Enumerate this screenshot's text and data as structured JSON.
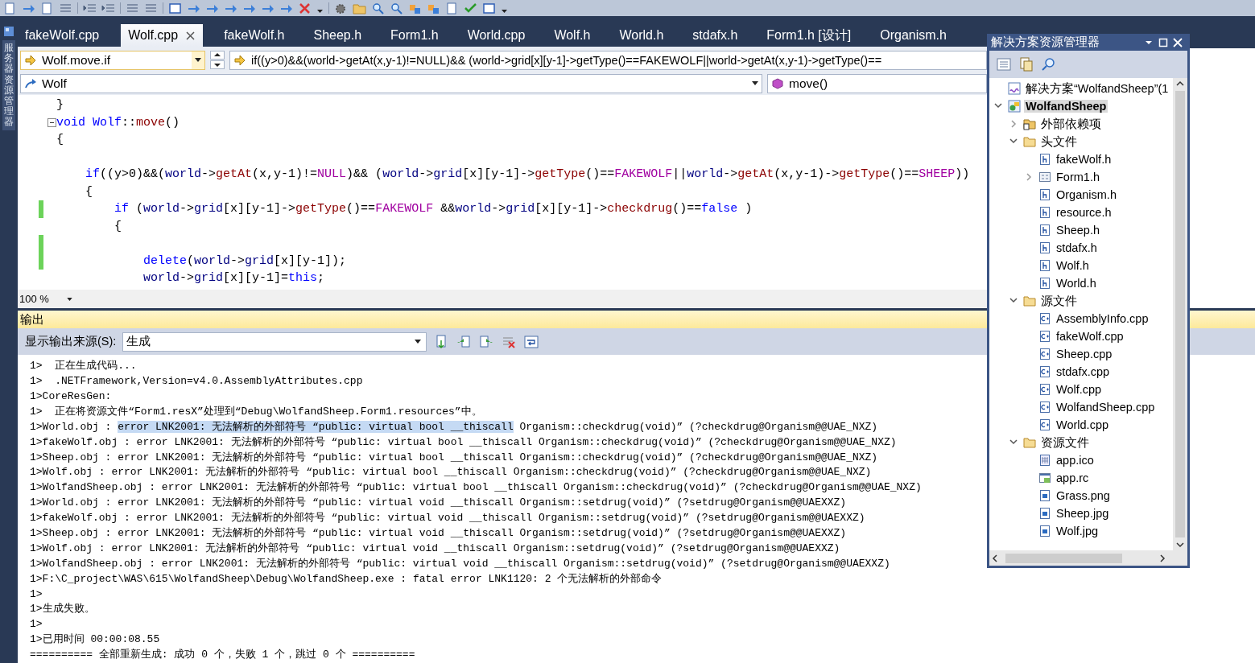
{
  "side_tab": {
    "label": "服务器资源管理器"
  },
  "tabs": [
    {
      "label": "fakeWolf.cpp",
      "selected": false
    },
    {
      "label": "Wolf.cpp",
      "selected": true
    },
    {
      "label": "fakeWolf.h",
      "selected": false
    },
    {
      "label": "Sheep.h",
      "selected": false
    },
    {
      "label": "Form1.h",
      "selected": false
    },
    {
      "label": "World.cpp",
      "selected": false
    },
    {
      "label": "Wolf.h",
      "selected": false
    },
    {
      "label": "World.h",
      "selected": false
    },
    {
      "label": "stdafx.h",
      "selected": false
    },
    {
      "label": "Form1.h [设计]",
      "selected": false
    },
    {
      "label": "Organism.h",
      "selected": false
    }
  ],
  "nav": {
    "scope_combo": "Wolf.move.if",
    "statement_field": "if((y>0)&&(world->getAt(x,y-1)!=NULL)&& (world->grid[x][y-1]->getType()==FAKEWOLF||world->getAt(x,y-1)->getType()==",
    "class_combo": "Wolf",
    "member_combo": "move()"
  },
  "code": {
    "lines": [
      {
        "changed": false,
        "foldable": false,
        "tokens": [
          {
            "kind": "plain",
            "text": "}"
          }
        ]
      },
      {
        "changed": false,
        "foldable": true,
        "tokens": [
          {
            "kind": "kw",
            "text": "void Wolf"
          },
          {
            "kind": "plain",
            "text": "::"
          },
          {
            "kind": "fn",
            "text": "move"
          },
          {
            "kind": "plain",
            "text": "()"
          }
        ]
      },
      {
        "changed": false,
        "foldable": false,
        "tokens": [
          {
            "kind": "plain",
            "text": "{"
          }
        ]
      },
      {
        "changed": false,
        "foldable": false
      },
      {
        "changed": false,
        "foldable": false,
        "tokens": [
          {
            "kind": "kw",
            "text": "    if"
          },
          {
            "kind": "plain",
            "text": "((y>0)&&("
          },
          {
            "kind": "var",
            "text": "world"
          },
          {
            "kind": "plain",
            "text": "->"
          },
          {
            "kind": "fn",
            "text": "getAt"
          },
          {
            "kind": "plain",
            "text": "(x,y-1)!="
          },
          {
            "kind": "macro",
            "text": "NULL"
          },
          {
            "kind": "plain",
            "text": ")&& ("
          },
          {
            "kind": "var",
            "text": "world"
          },
          {
            "kind": "plain",
            "text": "->"
          },
          {
            "kind": "var",
            "text": "grid"
          },
          {
            "kind": "plain",
            "text": "[x][y-1]->"
          },
          {
            "kind": "fn",
            "text": "getType"
          },
          {
            "kind": "plain",
            "text": "()=="
          },
          {
            "kind": "macro",
            "text": "FAKEWOLF"
          },
          {
            "kind": "plain",
            "text": "||"
          },
          {
            "kind": "var",
            "text": "world"
          },
          {
            "kind": "plain",
            "text": "->"
          },
          {
            "kind": "fn",
            "text": "getAt"
          },
          {
            "kind": "plain",
            "text": "(x,y-1)->"
          },
          {
            "kind": "fn",
            "text": "getType"
          },
          {
            "kind": "plain",
            "text": "()=="
          },
          {
            "kind": "macro",
            "text": "SHEEP"
          },
          {
            "kind": "plain",
            "text": "))"
          }
        ]
      },
      {
        "changed": false,
        "foldable": false,
        "tokens": [
          {
            "kind": "plain",
            "text": "    {"
          }
        ]
      },
      {
        "changed": true,
        "foldable": false,
        "tokens": [
          {
            "kind": "kw",
            "text": "        if"
          },
          {
            "kind": "plain",
            "text": " ("
          },
          {
            "kind": "var",
            "text": "world"
          },
          {
            "kind": "plain",
            "text": "->"
          },
          {
            "kind": "var",
            "text": "grid"
          },
          {
            "kind": "plain",
            "text": "[x][y-1]->"
          },
          {
            "kind": "fn",
            "text": "getType"
          },
          {
            "kind": "plain",
            "text": "()=="
          },
          {
            "kind": "macro",
            "text": "FAKEWOLF"
          },
          {
            "kind": "plain",
            "text": " &&"
          },
          {
            "kind": "var",
            "text": "world"
          },
          {
            "kind": "plain",
            "text": "->"
          },
          {
            "kind": "var",
            "text": "grid"
          },
          {
            "kind": "plain",
            "text": "[x][y-1]->"
          },
          {
            "kind": "fn",
            "text": "checkdrug"
          },
          {
            "kind": "plain",
            "text": "()=="
          },
          {
            "kind": "kw",
            "text": "false"
          },
          {
            "kind": "plain",
            "text": " )"
          }
        ]
      },
      {
        "changed": false,
        "foldable": false,
        "tokens": [
          {
            "kind": "plain",
            "text": "        {"
          }
        ]
      },
      {
        "changed": true,
        "foldable": false
      },
      {
        "changed": true,
        "foldable": false,
        "tokens": [
          {
            "kind": "kw",
            "text": "            delete"
          },
          {
            "kind": "plain",
            "text": "("
          },
          {
            "kind": "var",
            "text": "world"
          },
          {
            "kind": "plain",
            "text": "->"
          },
          {
            "kind": "var",
            "text": "grid"
          },
          {
            "kind": "plain",
            "text": "[x][y-1]);"
          }
        ]
      },
      {
        "changed": false,
        "foldable": false,
        "tokens": [
          {
            "kind": "var",
            "text": "            world"
          },
          {
            "kind": "plain",
            "text": "->"
          },
          {
            "kind": "var",
            "text": "grid"
          },
          {
            "kind": "plain",
            "text": "[x][y-1]="
          },
          {
            "kind": "kw",
            "text": "this"
          },
          {
            "kind": "plain",
            "text": ";"
          }
        ]
      }
    ]
  },
  "zoom_combo": "100 %",
  "output": {
    "title": "输出",
    "source_label": "显示输出来源(S):",
    "source_combo": "生成",
    "lines": [
      {
        "parts": [
          {
            "text": "1>  正在生成代码...",
            "selected": false
          }
        ]
      },
      {
        "parts": [
          {
            "text": "1>  .NETFramework,Version=v4.0.AssemblyAttributes.cpp",
            "selected": false
          }
        ]
      },
      {
        "parts": [
          {
            "text": "1>CoreResGen:",
            "selected": false
          }
        ]
      },
      {
        "parts": [
          {
            "text": "1>  正在将资源文件“Form1.resX”处理到“Debug\\WolfandSheep.Form1.resources”中。",
            "selected": false
          }
        ]
      },
      {
        "parts": [
          {
            "text": "1>World.obj : ",
            "selected": false
          },
          {
            "text": "error LNK2001: 无法解析的外部符号 “public: virtual bool __thiscall",
            "selected": true
          },
          {
            "text": " Organism::checkdrug(void)” (?checkdrug@Organism@@UAE_NXZ)",
            "selected": false
          }
        ]
      },
      {
        "parts": [
          {
            "text": "1>fakeWolf.obj : error LNK2001: 无法解析的外部符号 “public: virtual bool __thiscall Organism::checkdrug(void)” (?checkdrug@Organism@@UAE_NXZ)",
            "selected": false
          }
        ]
      },
      {
        "parts": [
          {
            "text": "1>Sheep.obj : error LNK2001: 无法解析的外部符号 “public: virtual bool __thiscall Organism::checkdrug(void)” (?checkdrug@Organism@@UAE_NXZ)",
            "selected": false
          }
        ]
      },
      {
        "parts": [
          {
            "text": "1>Wolf.obj : error LNK2001: 无法解析的外部符号 “public: virtual bool __thiscall Organism::checkdrug(void)” (?checkdrug@Organism@@UAE_NXZ)",
            "selected": false
          }
        ]
      },
      {
        "parts": [
          {
            "text": "1>WolfandSheep.obj : error LNK2001: 无法解析的外部符号 “public: virtual bool __thiscall Organism::checkdrug(void)” (?checkdrug@Organism@@UAE_NXZ)",
            "selected": false
          }
        ]
      },
      {
        "parts": [
          {
            "text": "1>World.obj : error LNK2001: 无法解析的外部符号 “public: virtual void __thiscall Organism::setdrug(void)” (?setdrug@Organism@@UAEXXZ)",
            "selected": false
          }
        ]
      },
      {
        "parts": [
          {
            "text": "1>fakeWolf.obj : error LNK2001: 无法解析的外部符号 “public: virtual void __thiscall Organism::setdrug(void)” (?setdrug@Organism@@UAEXXZ)",
            "selected": false
          }
        ]
      },
      {
        "parts": [
          {
            "text": "1>Sheep.obj : error LNK2001: 无法解析的外部符号 “public: virtual void __thiscall Organism::setdrug(void)” (?setdrug@Organism@@UAEXXZ)",
            "selected": false
          }
        ]
      },
      {
        "parts": [
          {
            "text": "1>Wolf.obj : error LNK2001: 无法解析的外部符号 “public: virtual void __thiscall Organism::setdrug(void)” (?setdrug@Organism@@UAEXXZ)",
            "selected": false
          }
        ]
      },
      {
        "parts": [
          {
            "text": "1>WolfandSheep.obj : error LNK2001: 无法解析的外部符号 “public: virtual void __thiscall Organism::setdrug(void)” (?setdrug@Organism@@UAEXXZ)",
            "selected": false
          }
        ]
      },
      {
        "parts": [
          {
            "text": "1>F:\\C_project\\WAS\\615\\WolfandSheep\\Debug\\WolfandSheep.exe : fatal error LNK1120: 2 个无法解析的外部命令",
            "selected": false
          }
        ]
      },
      {
        "parts": [
          {
            "text": "1>",
            "selected": false
          }
        ]
      },
      {
        "parts": [
          {
            "text": "1>生成失败。",
            "selected": false
          }
        ]
      },
      {
        "parts": [
          {
            "text": "1>",
            "selected": false
          }
        ]
      },
      {
        "parts": [
          {
            "text": "1>已用时间 00:00:08.55",
            "selected": false
          }
        ]
      },
      {
        "parts": [
          {
            "text": "========== 全部重新生成: 成功 0 个，失败 1 个，跳过 0 个 ==========",
            "selected": false
          }
        ]
      }
    ]
  },
  "solution_explorer": {
    "title": "解决方案资源管理器",
    "tree": [
      {
        "label": "解决方案“WolfandSheep”(1",
        "kind": "solution",
        "selected": false
      },
      {
        "label": "WolfandSheep",
        "kind": "project",
        "selected": true,
        "expanded": true,
        "children": [
          {
            "label": "外部依赖项",
            "kind": "references",
            "selected": false,
            "expanded": false
          },
          {
            "label": "头文件",
            "kind": "folder",
            "selected": false,
            "expanded": true,
            "children": [
              {
                "label": "fakeWolf.h",
                "kind": "header",
                "selected": false
              },
              {
                "label": "Form1.h",
                "kind": "form",
                "selected": false,
                "expanded": false
              },
              {
                "label": "Organism.h",
                "kind": "header",
                "selected": false
              },
              {
                "label": "resource.h",
                "kind": "header",
                "selected": false
              },
              {
                "label": "Sheep.h",
                "kind": "header",
                "selected": false
              },
              {
                "label": "stdafx.h",
                "kind": "header",
                "selected": false
              },
              {
                "label": "Wolf.h",
                "kind": "header",
                "selected": false
              },
              {
                "label": "World.h",
                "kind": "header",
                "selected": false
              }
            ]
          },
          {
            "label": "源文件",
            "kind": "folder",
            "selected": false,
            "expanded": true,
            "children": [
              {
                "label": "AssemblyInfo.cpp",
                "kind": "cpp",
                "selected": false
              },
              {
                "label": "fakeWolf.cpp",
                "kind": "cpp",
                "selected": false
              },
              {
                "label": "Sheep.cpp",
                "kind": "cpp",
                "selected": false
              },
              {
                "label": "stdafx.cpp",
                "kind": "cpp",
                "selected": false
              },
              {
                "label": "Wolf.cpp",
                "kind": "cpp",
                "selected": false
              },
              {
                "label": "WolfandSheep.cpp",
                "kind": "cpp",
                "selected": false
              },
              {
                "label": "World.cpp",
                "kind": "cpp",
                "selected": false
              }
            ]
          },
          {
            "label": "资源文件",
            "kind": "folder",
            "selected": false,
            "expanded": true,
            "children": [
              {
                "label": "app.ico",
                "kind": "ico",
                "selected": false
              },
              {
                "label": "app.rc",
                "kind": "rc",
                "selected": false
              },
              {
                "label": "Grass.png",
                "kind": "image",
                "selected": false
              },
              {
                "label": "Sheep.jpg",
                "kind": "image",
                "selected": false
              },
              {
                "label": "Wolf.jpg",
                "kind": "image",
                "selected": false
              }
            ]
          }
        ]
      }
    ]
  }
}
